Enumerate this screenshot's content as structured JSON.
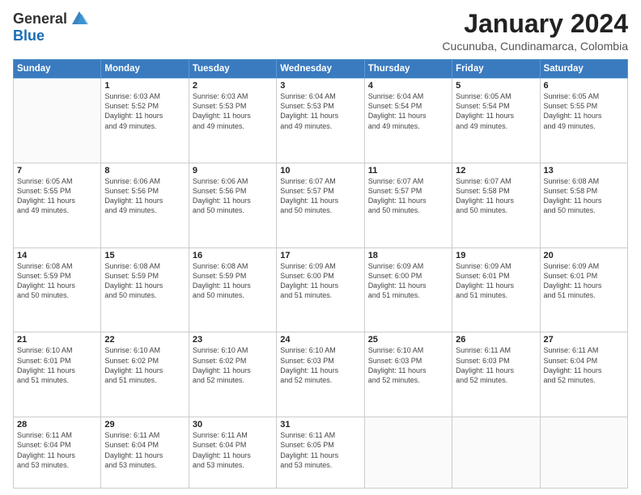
{
  "header": {
    "logo_general": "General",
    "logo_blue": "Blue",
    "month_title": "January 2024",
    "location": "Cucunuba, Cundinamarca, Colombia"
  },
  "days_of_week": [
    "Sunday",
    "Monday",
    "Tuesday",
    "Wednesday",
    "Thursday",
    "Friday",
    "Saturday"
  ],
  "weeks": [
    [
      {
        "day": "",
        "info": ""
      },
      {
        "day": "1",
        "info": "Sunrise: 6:03 AM\nSunset: 5:52 PM\nDaylight: 11 hours\nand 49 minutes."
      },
      {
        "day": "2",
        "info": "Sunrise: 6:03 AM\nSunset: 5:53 PM\nDaylight: 11 hours\nand 49 minutes."
      },
      {
        "day": "3",
        "info": "Sunrise: 6:04 AM\nSunset: 5:53 PM\nDaylight: 11 hours\nand 49 minutes."
      },
      {
        "day": "4",
        "info": "Sunrise: 6:04 AM\nSunset: 5:54 PM\nDaylight: 11 hours\nand 49 minutes."
      },
      {
        "day": "5",
        "info": "Sunrise: 6:05 AM\nSunset: 5:54 PM\nDaylight: 11 hours\nand 49 minutes."
      },
      {
        "day": "6",
        "info": "Sunrise: 6:05 AM\nSunset: 5:55 PM\nDaylight: 11 hours\nand 49 minutes."
      }
    ],
    [
      {
        "day": "7",
        "info": "Sunrise: 6:05 AM\nSunset: 5:55 PM\nDaylight: 11 hours\nand 49 minutes."
      },
      {
        "day": "8",
        "info": "Sunrise: 6:06 AM\nSunset: 5:56 PM\nDaylight: 11 hours\nand 49 minutes."
      },
      {
        "day": "9",
        "info": "Sunrise: 6:06 AM\nSunset: 5:56 PM\nDaylight: 11 hours\nand 50 minutes."
      },
      {
        "day": "10",
        "info": "Sunrise: 6:07 AM\nSunset: 5:57 PM\nDaylight: 11 hours\nand 50 minutes."
      },
      {
        "day": "11",
        "info": "Sunrise: 6:07 AM\nSunset: 5:57 PM\nDaylight: 11 hours\nand 50 minutes."
      },
      {
        "day": "12",
        "info": "Sunrise: 6:07 AM\nSunset: 5:58 PM\nDaylight: 11 hours\nand 50 minutes."
      },
      {
        "day": "13",
        "info": "Sunrise: 6:08 AM\nSunset: 5:58 PM\nDaylight: 11 hours\nand 50 minutes."
      }
    ],
    [
      {
        "day": "14",
        "info": "Sunrise: 6:08 AM\nSunset: 5:59 PM\nDaylight: 11 hours\nand 50 minutes."
      },
      {
        "day": "15",
        "info": "Sunrise: 6:08 AM\nSunset: 5:59 PM\nDaylight: 11 hours\nand 50 minutes."
      },
      {
        "day": "16",
        "info": "Sunrise: 6:08 AM\nSunset: 5:59 PM\nDaylight: 11 hours\nand 50 minutes."
      },
      {
        "day": "17",
        "info": "Sunrise: 6:09 AM\nSunset: 6:00 PM\nDaylight: 11 hours\nand 51 minutes."
      },
      {
        "day": "18",
        "info": "Sunrise: 6:09 AM\nSunset: 6:00 PM\nDaylight: 11 hours\nand 51 minutes."
      },
      {
        "day": "19",
        "info": "Sunrise: 6:09 AM\nSunset: 6:01 PM\nDaylight: 11 hours\nand 51 minutes."
      },
      {
        "day": "20",
        "info": "Sunrise: 6:09 AM\nSunset: 6:01 PM\nDaylight: 11 hours\nand 51 minutes."
      }
    ],
    [
      {
        "day": "21",
        "info": "Sunrise: 6:10 AM\nSunset: 6:01 PM\nDaylight: 11 hours\nand 51 minutes."
      },
      {
        "day": "22",
        "info": "Sunrise: 6:10 AM\nSunset: 6:02 PM\nDaylight: 11 hours\nand 51 minutes."
      },
      {
        "day": "23",
        "info": "Sunrise: 6:10 AM\nSunset: 6:02 PM\nDaylight: 11 hours\nand 52 minutes."
      },
      {
        "day": "24",
        "info": "Sunrise: 6:10 AM\nSunset: 6:03 PM\nDaylight: 11 hours\nand 52 minutes."
      },
      {
        "day": "25",
        "info": "Sunrise: 6:10 AM\nSunset: 6:03 PM\nDaylight: 11 hours\nand 52 minutes."
      },
      {
        "day": "26",
        "info": "Sunrise: 6:11 AM\nSunset: 6:03 PM\nDaylight: 11 hours\nand 52 minutes."
      },
      {
        "day": "27",
        "info": "Sunrise: 6:11 AM\nSunset: 6:04 PM\nDaylight: 11 hours\nand 52 minutes."
      }
    ],
    [
      {
        "day": "28",
        "info": "Sunrise: 6:11 AM\nSunset: 6:04 PM\nDaylight: 11 hours\nand 53 minutes."
      },
      {
        "day": "29",
        "info": "Sunrise: 6:11 AM\nSunset: 6:04 PM\nDaylight: 11 hours\nand 53 minutes."
      },
      {
        "day": "30",
        "info": "Sunrise: 6:11 AM\nSunset: 6:04 PM\nDaylight: 11 hours\nand 53 minutes."
      },
      {
        "day": "31",
        "info": "Sunrise: 6:11 AM\nSunset: 6:05 PM\nDaylight: 11 hours\nand 53 minutes."
      },
      {
        "day": "",
        "info": ""
      },
      {
        "day": "",
        "info": ""
      },
      {
        "day": "",
        "info": ""
      }
    ]
  ]
}
